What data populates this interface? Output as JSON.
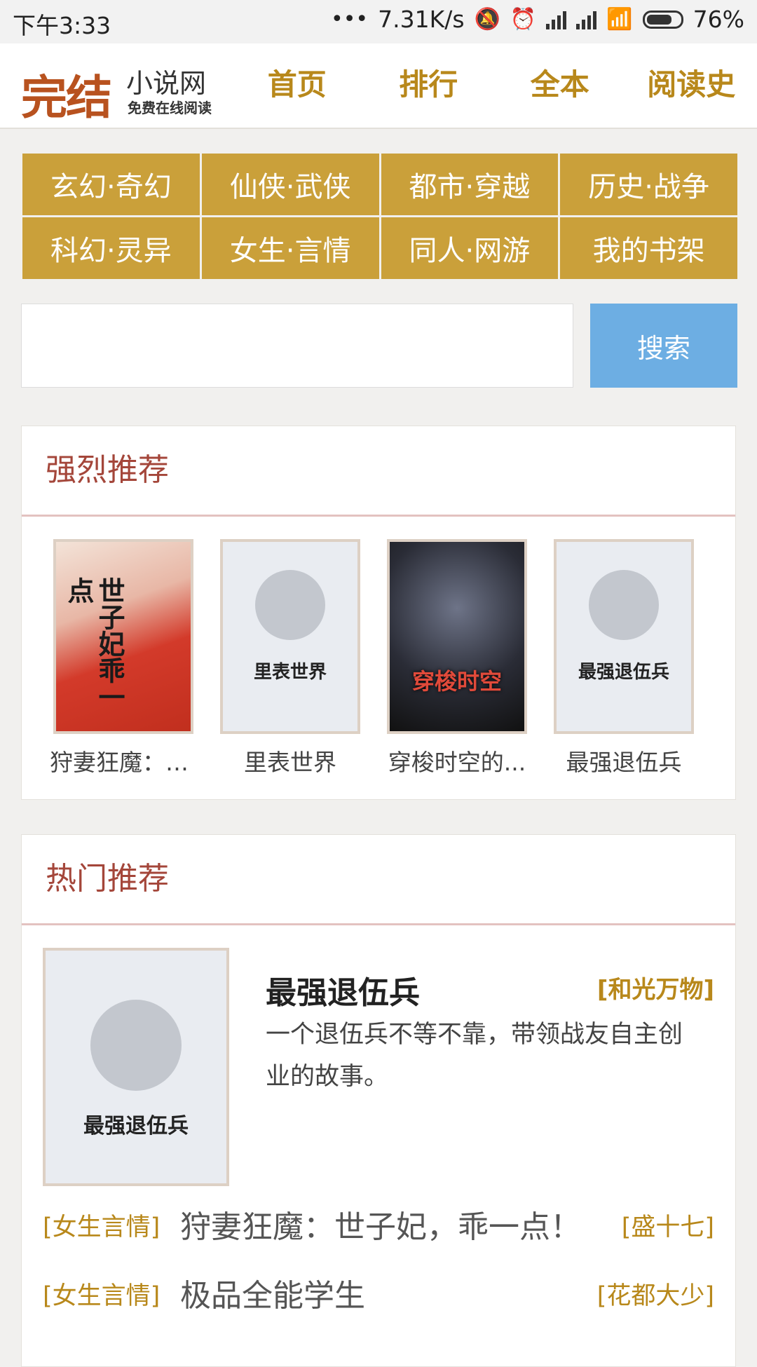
{
  "status_bar": {
    "time": "下午3:33",
    "dots": "•••",
    "speed": "7.31K/s",
    "battery": "76%",
    "battery_level": 0.76
  },
  "header": {
    "logo_main": "完结",
    "logo_sub": "小说网",
    "logo_tag": "免费在线阅读",
    "nav": [
      "首页",
      "排行",
      "全本",
      "阅读史"
    ]
  },
  "categories": [
    "玄幻·奇幻",
    "仙侠·武侠",
    "都市·穿越",
    "历史·战争",
    "科幻·灵异",
    "女生·言情",
    "同人·网游",
    "我的书架"
  ],
  "search": {
    "placeholder": "",
    "value": "",
    "button": "搜索"
  },
  "strong_recommend": {
    "title": "强烈推荐",
    "books": [
      {
        "title": "狩妻狂魔：世子妃，乖一点！",
        "display": "狩妻狂魔：世...",
        "cover_text": "世子妃乖一点"
      },
      {
        "title": "里表世界",
        "display": "里表世界",
        "cover_text": "里表世界"
      },
      {
        "title": "穿梭时空的...",
        "display": "穿梭时空的...",
        "cover_text": "穿梭时空"
      },
      {
        "title": "最强退伍兵",
        "display": "最强退伍兵",
        "cover_text": "最强退伍兵"
      }
    ]
  },
  "hot_recommend": {
    "title": "热门推荐",
    "featured": {
      "title": "最强退伍兵",
      "author": "[和光万物]",
      "description": "一个退伍兵不等不靠，带领战友自主创业的故事。",
      "cover_text": "最强退伍兵"
    },
    "list": [
      {
        "category": "[女生言情]",
        "title": "狩妻狂魔：世子妃，乖一点！",
        "author": "[盛十七]"
      },
      {
        "category": "[女生言情]",
        "title": "极品全能学生",
        "author": "[花都大少]"
      }
    ]
  }
}
